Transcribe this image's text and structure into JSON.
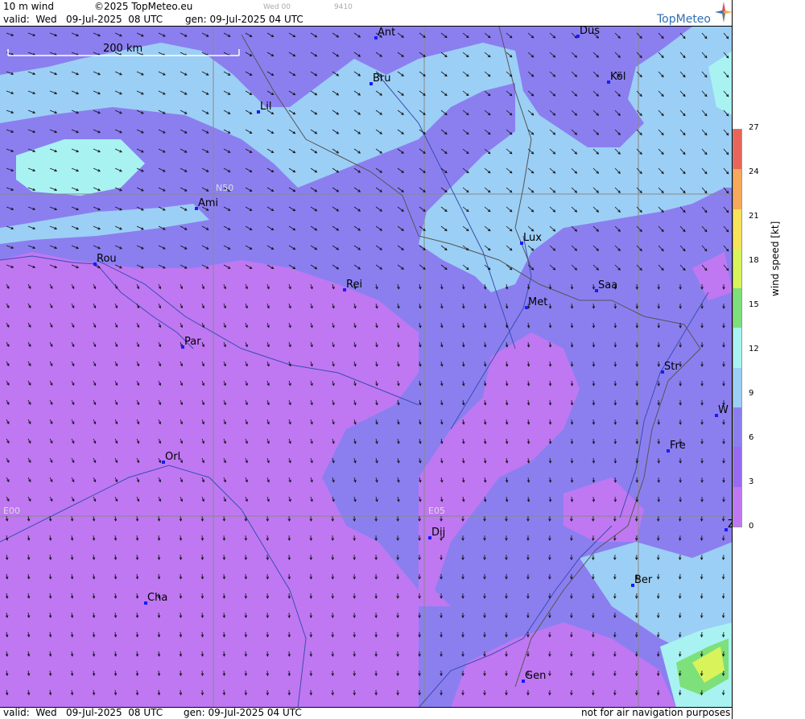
{
  "header": {
    "product": "10 m wind",
    "copyright": "©2025 TopMeteo.eu",
    "small_left": "Wed 00",
    "small_right": "9410",
    "valid": "valid:  Wed   09-Jul-2025  08 UTC",
    "gen": "gen: 09-Jul-2025 04 UTC",
    "brand": "TopMeteo"
  },
  "footer": {
    "valid": "valid:  Wed   09-Jul-2025  08 UTC",
    "gen": "gen: 09-Jul-2025 04 UTC",
    "notice": "not for air navigation purposes"
  },
  "scale_bar": {
    "label": "200 km"
  },
  "grid_labels": {
    "lat50": "N50",
    "lon0": "E00",
    "lon5": "E05"
  },
  "cities": [
    {
      "name": "Ant"
    },
    {
      "name": "Düs"
    },
    {
      "name": "Bru"
    },
    {
      "name": "Köl"
    },
    {
      "name": "Lil"
    },
    {
      "name": "Ami"
    },
    {
      "name": "Lux"
    },
    {
      "name": "Rou"
    },
    {
      "name": "Rei"
    },
    {
      "name": "Saa"
    },
    {
      "name": "Met"
    },
    {
      "name": "Par"
    },
    {
      "name": "Str"
    },
    {
      "name": "W"
    },
    {
      "name": "Fre"
    },
    {
      "name": "Orl"
    },
    {
      "name": "Dij"
    },
    {
      "name": "Z"
    },
    {
      "name": "Ber"
    },
    {
      "name": "Cha"
    },
    {
      "name": "Gen"
    }
  ],
  "legend": {
    "title": "wind speed [kt]",
    "ticks": [
      "27",
      "24",
      "21",
      "18",
      "15",
      "12",
      "9",
      "6",
      "3",
      "0"
    ],
    "colors": [
      "#e8655a",
      "#f7a85b",
      "#f6e35a",
      "#d9f45a",
      "#7de07a",
      "#a9f2f2",
      "#9ccff5",
      "#8b7ff0",
      "#9a6bf2",
      "#bf78f2"
    ]
  }
}
